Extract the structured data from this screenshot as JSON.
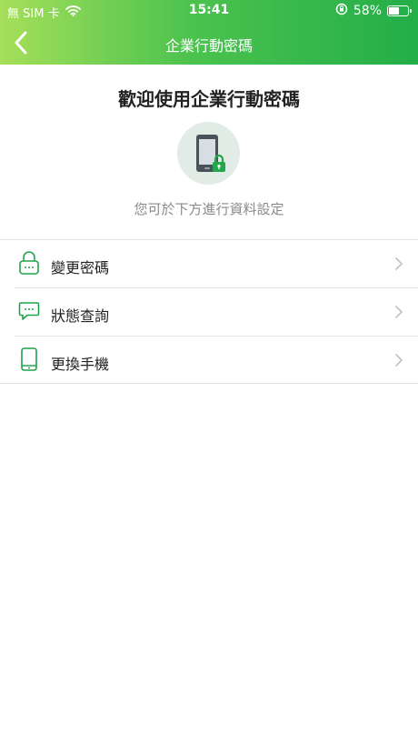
{
  "status_bar": {
    "carrier": "無 SIM 卡",
    "time": "15:41",
    "battery_percent": "58%",
    "battery_level": 0.58,
    "icons": [
      "wifi-icon",
      "orientation-lock-icon",
      "battery-icon"
    ]
  },
  "nav": {
    "title": "企業行動密碼",
    "back_icon": "chevron-left-icon"
  },
  "welcome": {
    "title": "歡迎使用企業行動密碼",
    "hint": "您可於下方進行資料設定",
    "hero_icon": "phone-lock-icon"
  },
  "menu": [
    {
      "label": "變更密碼",
      "icon": "lock-icon"
    },
    {
      "label": "狀態查詢",
      "icon": "chat-bubble-icon"
    },
    {
      "label": "更換手機",
      "icon": "phone-icon"
    }
  ],
  "colors": {
    "brand_green": "#23ae48",
    "header_gradient_start": "#a6df5a",
    "header_gradient_end": "#23ae48",
    "icon_green": "#1fa34a"
  }
}
